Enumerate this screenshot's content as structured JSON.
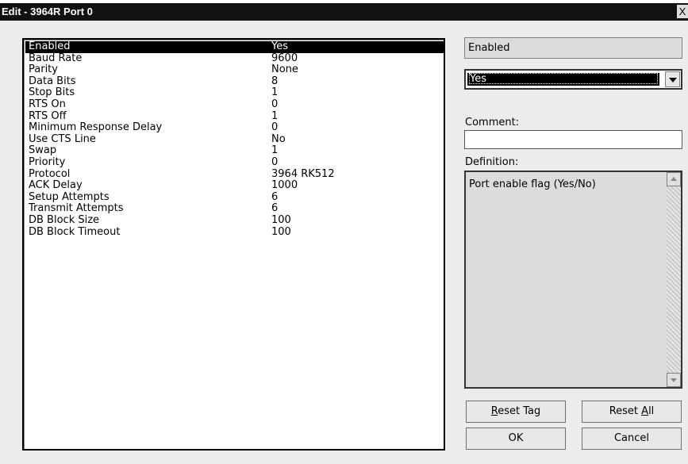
{
  "window": {
    "title": "Edit - 3964R Port 0",
    "close_glyph": "X"
  },
  "list": {
    "rows": [
      {
        "name": "Enabled",
        "value": "Yes"
      },
      {
        "name": "Baud Rate",
        "value": "9600"
      },
      {
        "name": "Parity",
        "value": "None"
      },
      {
        "name": "Data Bits",
        "value": "8"
      },
      {
        "name": "Stop Bits",
        "value": "1"
      },
      {
        "name": "RTS On",
        "value": "0"
      },
      {
        "name": "RTS Off",
        "value": "1"
      },
      {
        "name": "Minimum Response Delay",
        "value": "0"
      },
      {
        "name": "Use CTS Line",
        "value": "No"
      },
      {
        "name": "Swap",
        "value": "1"
      },
      {
        "name": "Priority",
        "value": "0"
      },
      {
        "name": "Protocol",
        "value": "3964 RK512"
      },
      {
        "name": "ACK Delay",
        "value": "1000"
      },
      {
        "name": "Setup Attempts",
        "value": "6"
      },
      {
        "name": "Transmit Attempts",
        "value": "6"
      },
      {
        "name": "DB Block Size",
        "value": "100"
      },
      {
        "name": "DB Block Timeout",
        "value": "100"
      }
    ],
    "selected_index": 0
  },
  "editor": {
    "field_name": "Enabled",
    "value": "Yes",
    "comment_label": "Comment:",
    "comment_value": "",
    "definition_label": "Definition:",
    "definition_text": "Port enable flag (Yes/No)"
  },
  "buttons": {
    "reset_tag": {
      "pre": "",
      "key": "R",
      "post": "eset Tag"
    },
    "reset_all": {
      "pre": "Reset ",
      "key": "A",
      "post": "ll"
    },
    "ok": "OK",
    "cancel": "Cancel"
  },
  "colors": {
    "selection": "#000000",
    "titlebar": "#111111",
    "background": "#ececec"
  }
}
